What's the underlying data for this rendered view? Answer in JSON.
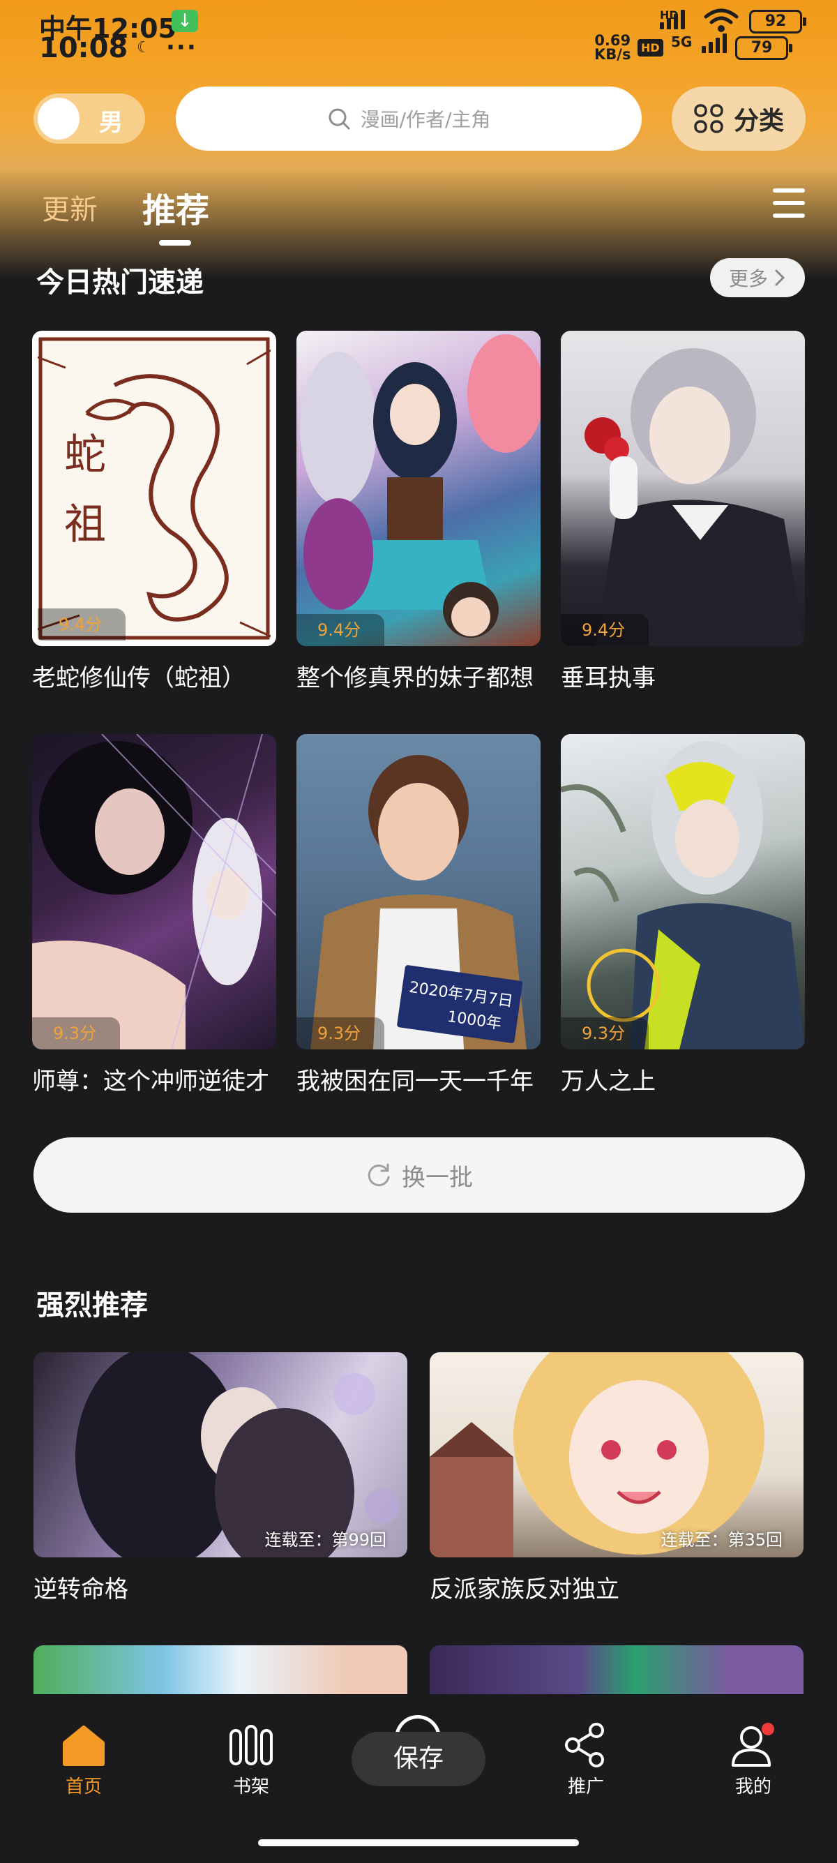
{
  "status_bar": {
    "time_top": "中午12:05",
    "time_bottom": "10:08",
    "dots": "···",
    "net_speed_value": "0.69",
    "net_speed_unit": "KB/s",
    "hd_badge": "HD",
    "net_top": "HD",
    "net_type": "5G",
    "battery1": "92",
    "battery2": "79"
  },
  "top_bar": {
    "gender_label": "男",
    "search_placeholder": "漫画/作者/主角",
    "category_label": "分类"
  },
  "tabs": [
    {
      "label": "更新",
      "active": false
    },
    {
      "label": "推荐",
      "active": true
    }
  ],
  "hot_section": {
    "title": "今日热门速递",
    "more_label": "更多",
    "items": [
      {
        "title": "老蛇修仙传（蛇祖）",
        "score": "9.4分"
      },
      {
        "title": "整个修真界的妹子都想",
        "score": "9.4分"
      },
      {
        "title": "垂耳执事",
        "score": "9.4分"
      },
      {
        "title": "师尊：这个冲师逆徒才",
        "score": "9.3分"
      },
      {
        "title": "我被困在同一天一千年",
        "score": "9.3分"
      },
      {
        "title": "万人之上",
        "score": "9.3分"
      }
    ],
    "refresh_label": "换一批"
  },
  "strong_section": {
    "title": "强烈推荐",
    "items": [
      {
        "title": "逆转命格",
        "episode": "连载至：第99回"
      },
      {
        "title": "反派家族反对独立",
        "episode": "连载至：第35回"
      }
    ]
  },
  "cover_art": {
    "snake_text1": "蛇",
    "snake_text2": "祖",
    "calendar_text": "2020年7月7日",
    "calendar_count": "1000年"
  },
  "bottom_nav": {
    "items": [
      {
        "label": "首页",
        "icon": "home-icon",
        "active": true
      },
      {
        "label": "书架",
        "icon": "bookshelf-icon",
        "active": false
      },
      {
        "label": "推广",
        "icon": "share-icon",
        "active": false
      },
      {
        "label": "我的",
        "icon": "profile-icon",
        "active": false
      }
    ],
    "save_label": "保存"
  },
  "colors": {
    "accent": "#f59a25",
    "header": "#f4a326",
    "background": "#1b1b1d"
  }
}
